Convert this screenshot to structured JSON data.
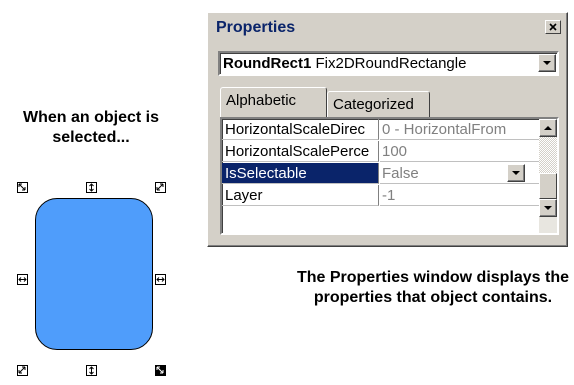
{
  "captions": {
    "left": "When an object is selected...",
    "right": "The Properties window displays the properties that object contains."
  },
  "properties_window": {
    "title": "Properties",
    "object_name": "RoundRect1",
    "object_type": "Fix2DRoundRectangle",
    "tabs": [
      "Alphabetic",
      "Categorized"
    ],
    "active_tab": "Alphabetic",
    "rows": [
      {
        "name": "HorizontalScaleDirec",
        "value": "0 - HorizontalFrom"
      },
      {
        "name": "HorizontalScalePerce",
        "value": "100"
      },
      {
        "name": "IsSelectable",
        "value": "False"
      },
      {
        "name": "Layer",
        "value": "-1"
      }
    ],
    "selected_row": "IsSelectable"
  },
  "colors": {
    "shape_fill": "#4f9dfb",
    "selection_highlight": "#0a246a",
    "title_text": "#0a246a"
  },
  "icons": {
    "close": "close-icon",
    "dropdown": "chevron-down-icon",
    "scroll_up": "scroll-up-icon",
    "scroll_down": "scroll-down-icon",
    "handles": [
      "resize-diagonal-icon",
      "resize-vertical-icon",
      "resize-horizontal-icon",
      "rotate-handle-icon"
    ]
  }
}
